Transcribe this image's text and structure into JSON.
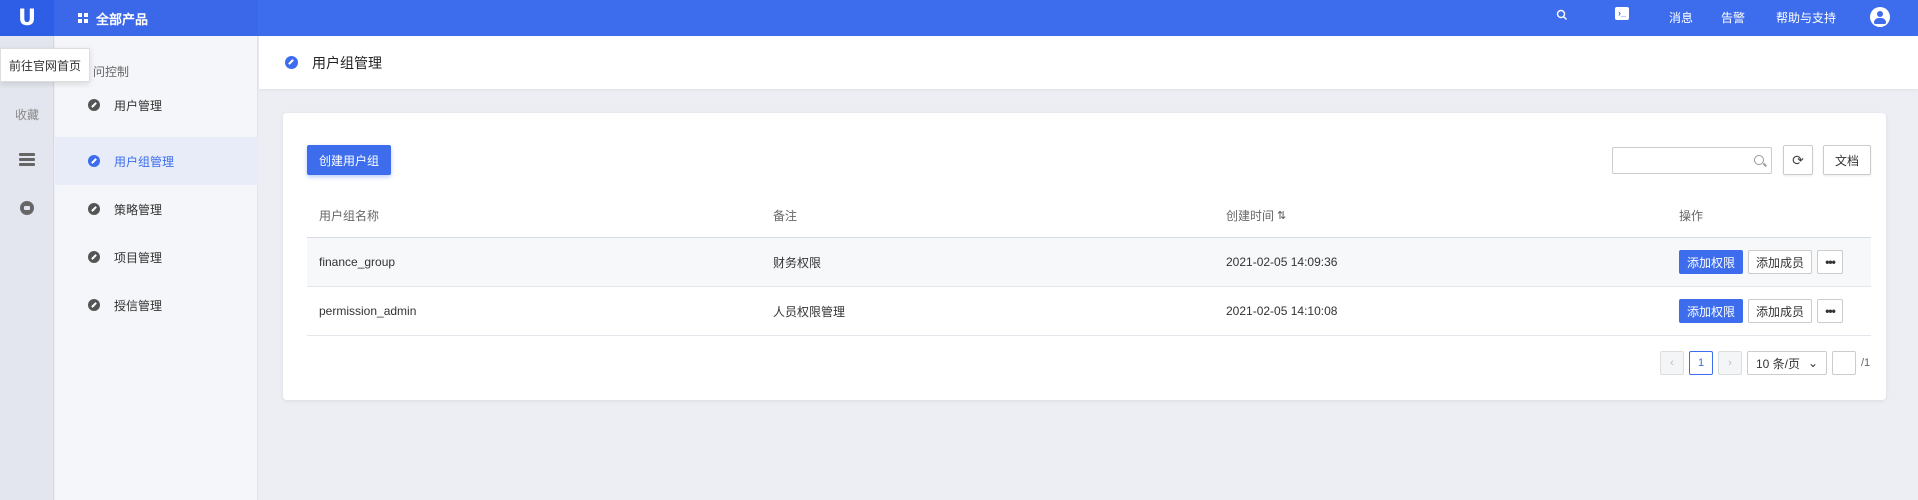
{
  "topbar": {
    "logo": "U",
    "all_products": "全部产品",
    "search_icon": "search-icon",
    "terminal_icon": "terminal-icon",
    "messages": "消息",
    "alarm": "告警",
    "help": "帮助与支持",
    "user_icon": "user-avatar-icon"
  },
  "tooltip": {
    "text": "前往官网首页"
  },
  "rail": {
    "favorites": "收藏"
  },
  "subnav": {
    "title": "问控制",
    "items": [
      {
        "label": "用户管理"
      },
      {
        "label": "用户组管理",
        "active": true
      },
      {
        "label": "策略管理"
      },
      {
        "label": "项目管理"
      },
      {
        "label": "授信管理"
      }
    ]
  },
  "page": {
    "title": "用户组管理"
  },
  "toolbar": {
    "create_label": "创建用户组",
    "search_placeholder": "",
    "doc_label": "文档"
  },
  "table": {
    "headers": [
      "用户组名称",
      "备注",
      "创建时间",
      "操作"
    ],
    "rows": [
      {
        "name": "finance_group",
        "remark": "财务权限",
        "created": "2021-02-05 14:09:36"
      },
      {
        "name": "permission_admin",
        "remark": "人员权限管理",
        "created": "2021-02-05 14:10:08"
      }
    ],
    "ops": {
      "add_perm": "添加权限",
      "add_member": "添加成员",
      "more": "•••"
    }
  },
  "pagination": {
    "current_page": "1",
    "page_size": "10 条/页",
    "total_pages": "/1"
  },
  "colors": {
    "primary": "#3d6ded",
    "topbar": "#3d6ded"
  }
}
